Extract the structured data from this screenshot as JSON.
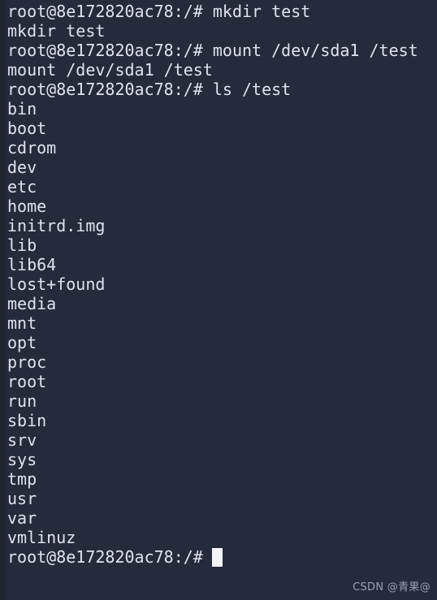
{
  "terminal": {
    "background_color": "#262b3b",
    "text_color": "#dfe2ee",
    "cursor_color": "#f4f4f8",
    "prompt": "root@8e172820ac78:/#",
    "lines": [
      "root@8e172820ac78:/# mkdir test",
      "mkdir test",
      "root@8e172820ac78:/# mount /dev/sda1 /test",
      "mount /dev/sda1 /test",
      "root@8e172820ac78:/# ls /test",
      "bin",
      "boot",
      "cdrom",
      "dev",
      "etc",
      "home",
      "initrd.img",
      "lib",
      "lib64",
      "lost+found",
      "media",
      "mnt",
      "opt",
      "proc",
      "root",
      "run",
      "sbin",
      "srv",
      "sys",
      "tmp",
      "usr",
      "var",
      "vmlinuz"
    ],
    "final_prompt": "root@8e172820ac78:/#"
  },
  "watermark": {
    "text": "CSDN @青果@",
    "color": "#9a9fb0"
  }
}
